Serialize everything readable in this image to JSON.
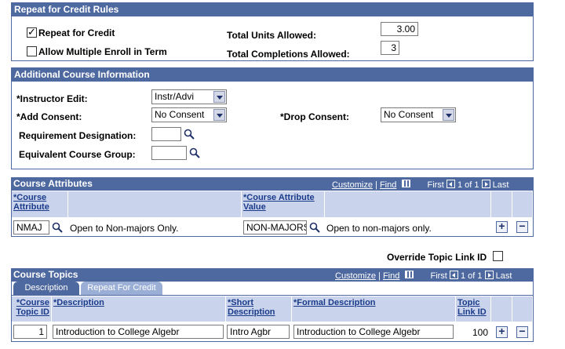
{
  "repeat_panel": {
    "title": "Repeat for Credit Rules",
    "repeat_for_credit_label": "Repeat for Credit",
    "repeat_for_credit_checked": true,
    "allow_multiple_label": "Allow Multiple Enroll in Term",
    "allow_multiple_checked": false,
    "total_units_label": "Total Units Allowed:",
    "total_units_value": "3.00",
    "total_completions_label": "Total Completions Allowed:",
    "total_completions_value": "3"
  },
  "additional_panel": {
    "title": "Additional Course Information",
    "instructor_edit_label": "*Instructor Edit:",
    "instructor_edit_value": "Instr/Advi",
    "add_consent_label": "*Add Consent:",
    "add_consent_value": "No Consent",
    "drop_consent_label": "*Drop Consent:",
    "drop_consent_value": "No Consent",
    "req_designation_label": "Requirement Designation:",
    "req_designation_value": "",
    "equiv_group_label": "Equivalent Course Group:",
    "equiv_group_value": ""
  },
  "attributes_grid": {
    "title": "Course Attributes",
    "customize": "Customize",
    "find": "Find",
    "first": "First",
    "count": "1 of 1",
    "last": "Last",
    "col_attribute": "*Course Attribute",
    "col_attribute_value": "*Course Attribute Value",
    "rows": [
      {
        "attribute": "NMAJ",
        "attribute_desc": "Open to Non-majors Only.",
        "value": "NON-MAJORS",
        "value_desc": "Open to non-majors only."
      }
    ]
  },
  "override_topic_label": "Override Topic Link ID",
  "override_topic_checked": false,
  "topics_grid": {
    "title": "Course Topics",
    "customize": "Customize",
    "find": "Find",
    "first": "First",
    "count": "1 of 1",
    "last": "Last",
    "tabs": [
      "Description",
      "Repeat For Credit"
    ],
    "col_topic_id": "*Course Topic ID",
    "col_description": "*Description",
    "col_short": "*Short Description",
    "col_formal": "*Formal Description",
    "col_link": "Topic Link ID",
    "rows": [
      {
        "topic_id": "1",
        "description": "Introduction to College Algebr",
        "short": "Intro Agbr",
        "formal": "Introduction to College Algebr",
        "link": "100"
      }
    ]
  },
  "colors": {
    "header_blue": "#4e68a0",
    "column_header": "#c9d4ec",
    "link_blue": "#1a3a8a"
  }
}
